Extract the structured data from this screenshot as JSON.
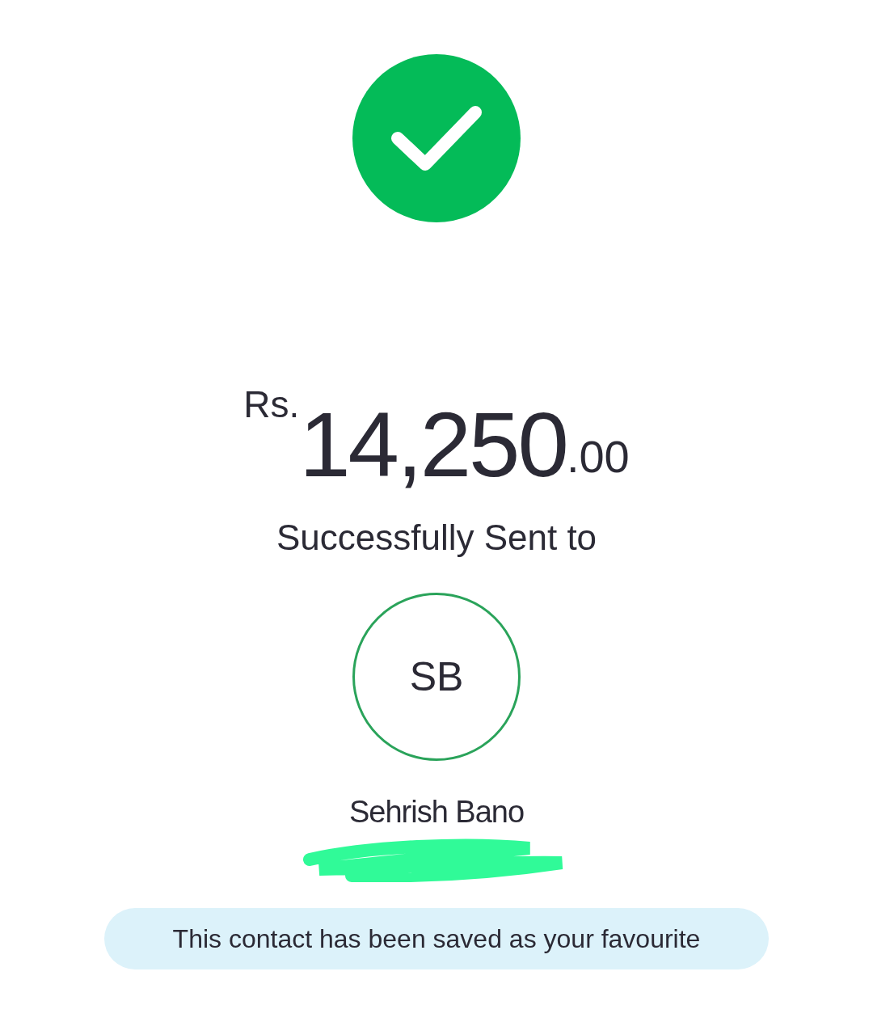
{
  "amount": {
    "currency": "Rs.",
    "whole": "14,250",
    "fraction": ".00"
  },
  "status_text": "Successfully Sent to",
  "recipient": {
    "initials": "SB",
    "name": "Sehrish Bano"
  },
  "notice": "This contact has been saved as your favourite"
}
